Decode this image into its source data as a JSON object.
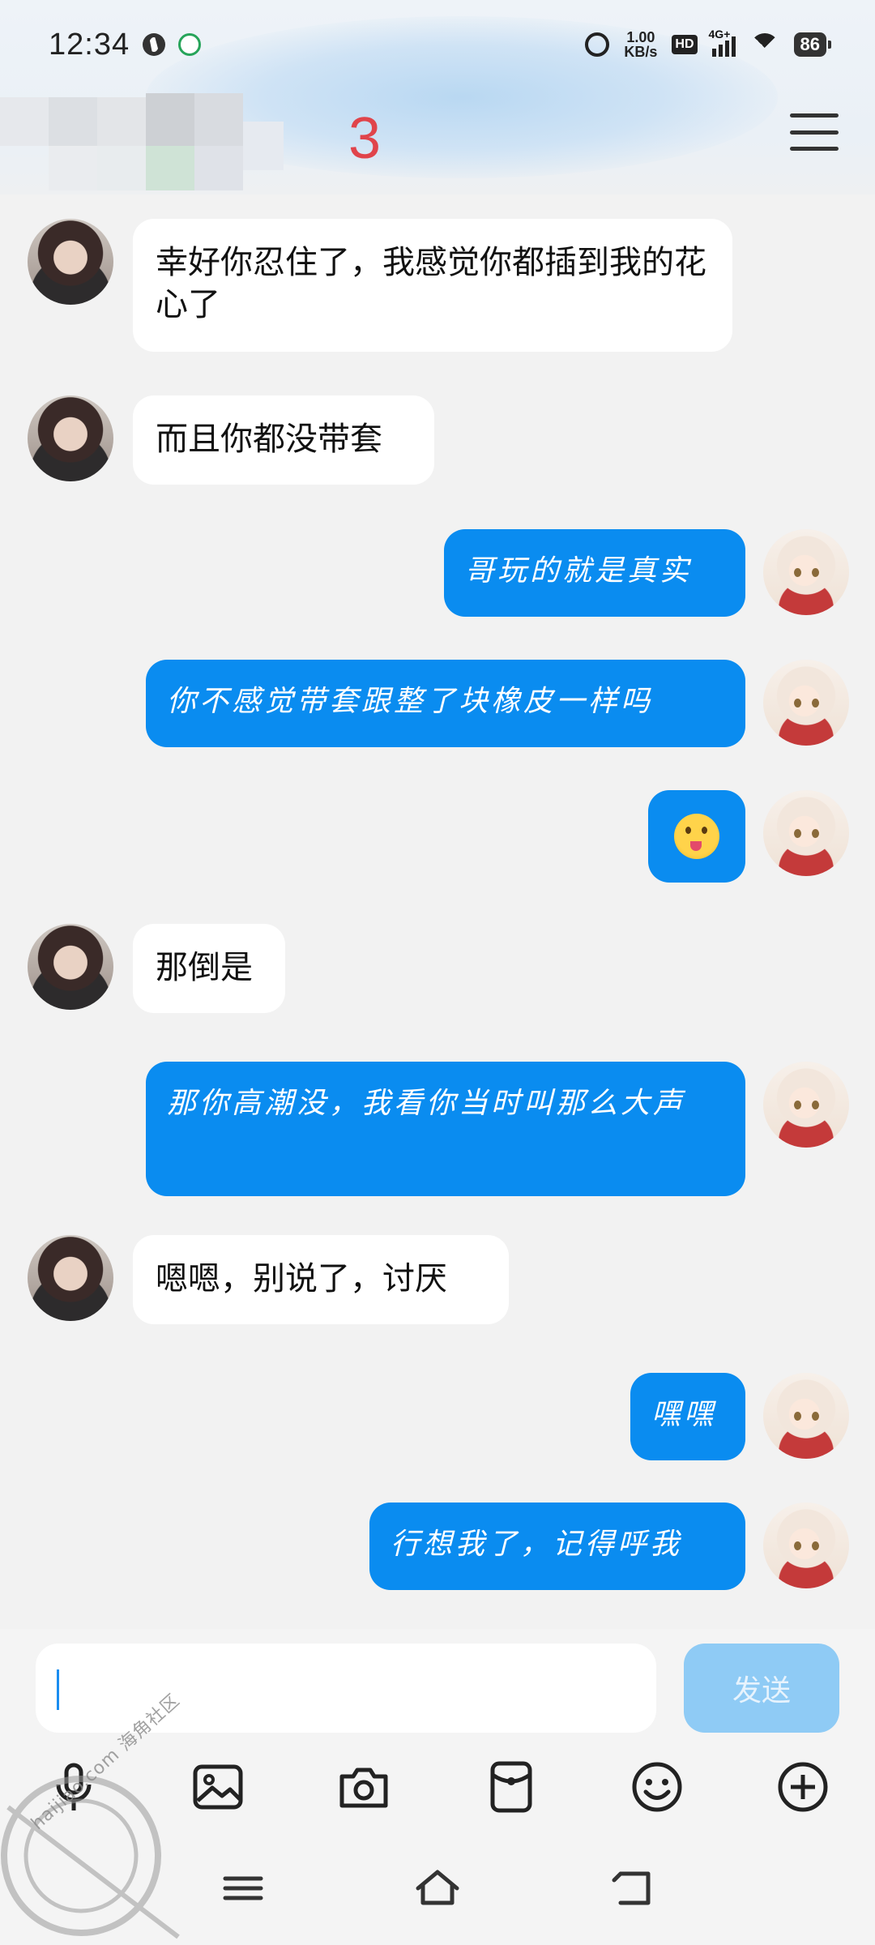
{
  "status_bar": {
    "time": "12:34",
    "net_speed_value": "1.00",
    "net_speed_unit": "KB/s",
    "hd_label": "HD",
    "network_label": "4G+",
    "battery": "86"
  },
  "header": {
    "title": "3"
  },
  "messages": [
    {
      "side": "in",
      "text": "幸好你忍住了，我感觉你都插到我的花心了"
    },
    {
      "side": "in",
      "text": "而且你都没带套"
    },
    {
      "side": "out",
      "text": "哥玩的就是真实"
    },
    {
      "side": "out",
      "text": "你不感觉带套跟整了块橡皮一样吗"
    },
    {
      "side": "out",
      "emoji": "tongue-face-emoji"
    },
    {
      "side": "in",
      "text": "那倒是"
    },
    {
      "side": "out",
      "text": "那你高潮没，我看你当时叫那么大声"
    },
    {
      "side": "in",
      "text": "嗯嗯，别说了，讨厌"
    },
    {
      "side": "out",
      "text": "嘿嘿"
    },
    {
      "side": "out",
      "text": "行想我了，记得呼我"
    }
  ],
  "composer": {
    "input_value": "",
    "send_label": "发送"
  },
  "toolbar_icons": [
    "microphone-icon",
    "image-icon",
    "camera-icon",
    "red-packet-icon",
    "emoji-icon",
    "plus-icon"
  ],
  "nav_icons": [
    "recent-apps-icon",
    "home-icon",
    "back-icon"
  ],
  "watermark": {
    "text": "haijiao.com",
    "cn": "海角社区"
  },
  "colors": {
    "outgoing_bubble": "#0a8cf0",
    "incoming_bubble": "#ffffff",
    "title": "#e0444b",
    "send_button": "#8fcbf5"
  }
}
